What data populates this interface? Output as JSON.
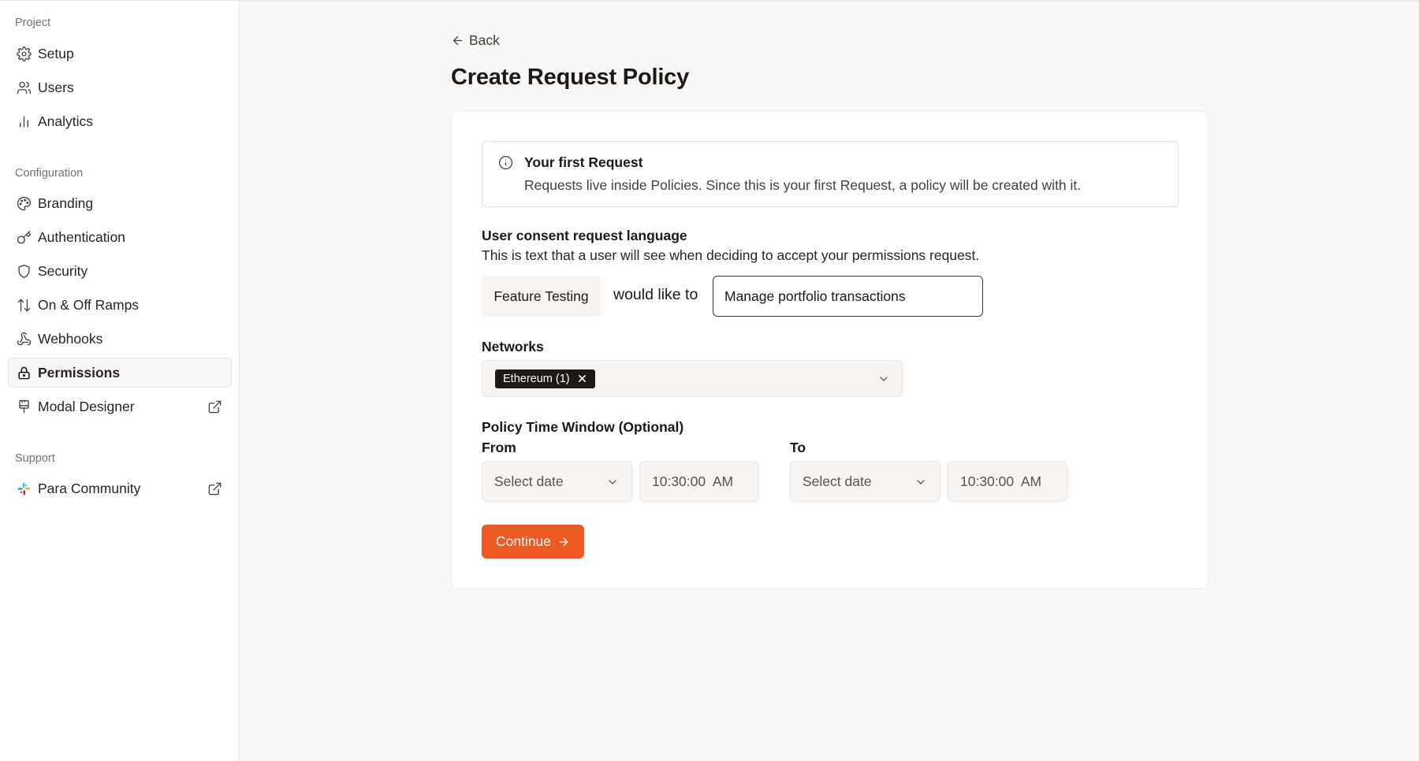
{
  "sidebar": {
    "sections": {
      "project": "Project",
      "configuration": "Configuration",
      "support": "Support"
    },
    "items": {
      "setup": {
        "label": "Setup",
        "icon": "gear-icon"
      },
      "users": {
        "label": "Users",
        "icon": "users-icon"
      },
      "analytics": {
        "label": "Analytics",
        "icon": "bar-chart-icon"
      },
      "branding": {
        "label": "Branding",
        "icon": "palette-icon"
      },
      "authentication": {
        "label": "Authentication",
        "icon": "key-icon"
      },
      "security": {
        "label": "Security",
        "icon": "shield-icon"
      },
      "ramps": {
        "label": "On & Off Ramps",
        "icon": "arrows-up-down-icon"
      },
      "webhooks": {
        "label": "Webhooks",
        "icon": "webhook-icon"
      },
      "permissions": {
        "label": "Permissions",
        "icon": "lock-icon",
        "active": true
      },
      "modal_designer": {
        "label": "Modal Designer",
        "icon": "brush-icon",
        "external": true
      },
      "para_community": {
        "label": "Para Community",
        "icon": "slack-icon",
        "external": true
      }
    }
  },
  "main": {
    "back_label": "Back",
    "title": "Create Request Policy",
    "info": {
      "title": "Your first Request",
      "text": "Requests live inside Policies. Since this is your first Request, a policy will be created with it."
    },
    "consent": {
      "label": "User consent request language",
      "description": "This is text that a user will see when deciding to accept your permissions request.",
      "app_name": "Feature Testing",
      "connector": "would like to",
      "value": "Manage portfolio transactions"
    },
    "networks": {
      "label": "Networks",
      "selected": [
        "Ethereum (1)"
      ]
    },
    "time_window": {
      "label": "Policy Time Window (Optional)",
      "from_label": "From",
      "to_label": "To",
      "from_date_placeholder": "Select date",
      "from_time": "10:30:00  AM",
      "to_date_placeholder": "Select date",
      "to_time": "10:30:00  AM"
    },
    "continue_label": "Continue"
  },
  "colors": {
    "accent": "#ef5a24",
    "background": "#faf8f6",
    "tag_bg": "#1c1917"
  }
}
